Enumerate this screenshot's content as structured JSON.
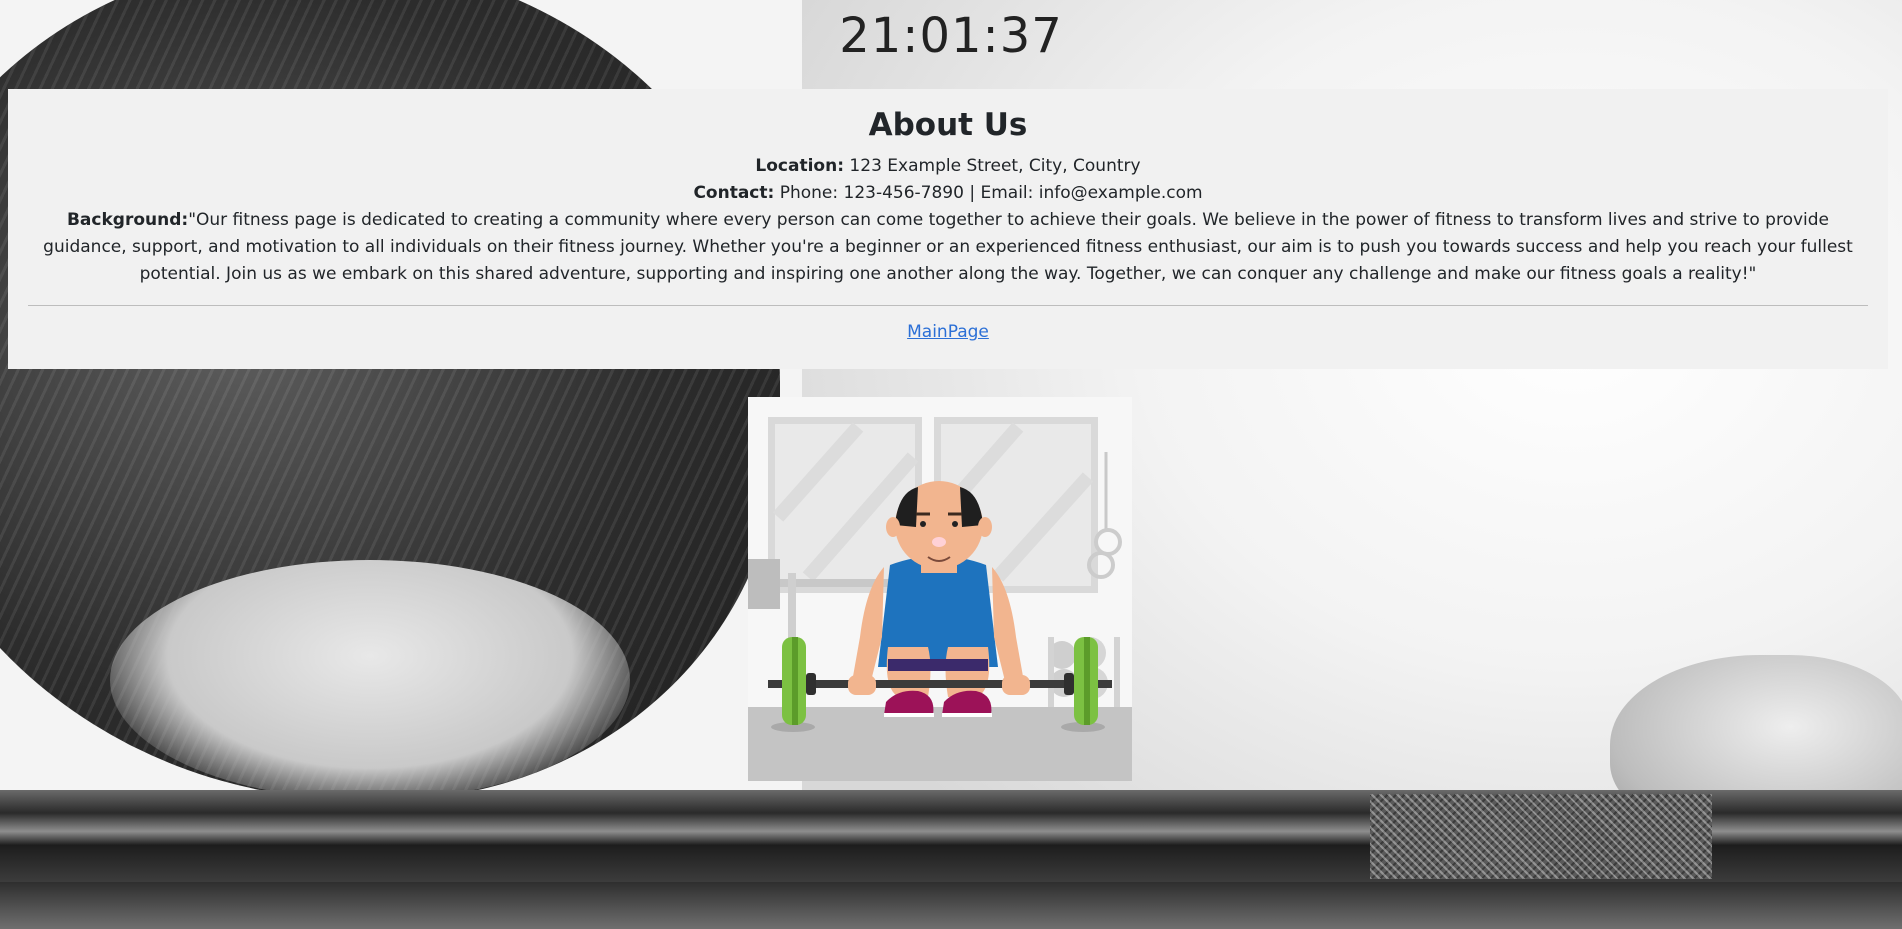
{
  "clock": {
    "time": "21:01:37"
  },
  "about": {
    "title": "About Us",
    "location_label": "Location:",
    "location_value": " 123 Example Street, City, Country",
    "contact_label": "Contact:",
    "contact_value": " Phone: 123-456-7890 | Email: info@example.com",
    "background_label": "Background:",
    "background_value": "\"Our fitness page is dedicated to creating a community where every person can come together to achieve their goals. We believe in the power of fitness to transform lives and strive to provide guidance, support, and motivation to all individuals on their fitness journey. Whether you're a beginner or an experienced fitness enthusiast, our aim is to push you towards success and help you reach your fullest potential. Join us as we embark on this shared adventure, supporting and inspiring one another along the way. Together, we can conquer any challenge and make our fitness goals a reality!\"",
    "link_label": "MainPage"
  },
  "colors": {
    "panel_bg": "#f1f1f1",
    "link": "#2b6fd6",
    "text": "#212529"
  },
  "icons": {
    "illustration": "weightlifter-illustration"
  }
}
